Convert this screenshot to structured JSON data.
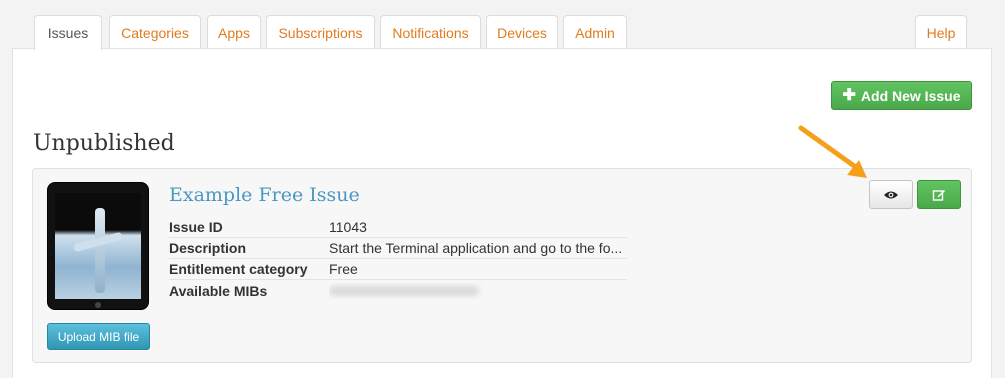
{
  "tabs": [
    {
      "label": "Issues"
    },
    {
      "label": "Categories"
    },
    {
      "label": "Apps"
    },
    {
      "label": "Subscriptions"
    },
    {
      "label": "Notifications"
    },
    {
      "label": "Devices"
    },
    {
      "label": "Admin"
    },
    {
      "label": "Help"
    }
  ],
  "toolbar": {
    "add_label": "Add New Issue",
    "add_icon": "plus-icon"
  },
  "section": {
    "title": "Unpublished"
  },
  "issue": {
    "title": "Example Free Issue",
    "upload_label": "Upload MIB file",
    "fields": [
      {
        "key": "Issue ID",
        "value": "11043"
      },
      {
        "key": "Description",
        "value": "Start the Terminal application and go to the fo..."
      },
      {
        "key": "Entitlement category",
        "value": "Free"
      },
      {
        "key": "Available MIBs",
        "value": ""
      }
    ],
    "view_icon": "eye-icon",
    "edit_icon": "edit-icon"
  },
  "colors": {
    "tab_text": "#e07b1f",
    "accent_green": "#4aa84a",
    "link_blue": "#4a97c4",
    "info_blue": "#2f96b4",
    "arrow_orange": "#f5a01a"
  }
}
